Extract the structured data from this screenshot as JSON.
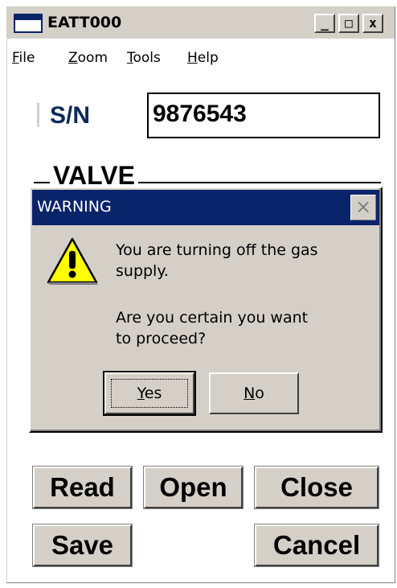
{
  "window": {
    "title": "EATT000",
    "caption_buttons": [
      "_",
      "□",
      "x"
    ]
  },
  "menu": [
    {
      "label": "File",
      "accel": "F",
      "rest": "ile"
    },
    {
      "label": "Zoom",
      "accel": "Z",
      "rest": "oom"
    },
    {
      "label": "Tools",
      "accel": "T",
      "rest": "ools"
    },
    {
      "label": "Help",
      "accel": "H",
      "rest": "elp"
    }
  ],
  "form": {
    "sn_label": "S/N",
    "sn_value": "9876543",
    "valve_label": "VALVE"
  },
  "buttons": {
    "read": "Read",
    "open": "Open",
    "close": "Close",
    "save": "Save",
    "cancel": "Cancel"
  },
  "dialog": {
    "title": "WARNING",
    "close_glyph": "×",
    "icon": "warning-triangle-icon",
    "message_line1": "You are turning off the gas",
    "message_line2": "supply.",
    "question_line1": "Are you certain you want",
    "question_line2": "to proceed?",
    "yes": {
      "accel": "Y",
      "rest": "es"
    },
    "no": {
      "accel": "N",
      "rest": "o"
    }
  },
  "colors": {
    "title_bar_active": "#0a246a",
    "button_face": "#d4d0c8",
    "sn_label": "#0a2a5a",
    "warning_yellow": "#ffff00"
  }
}
